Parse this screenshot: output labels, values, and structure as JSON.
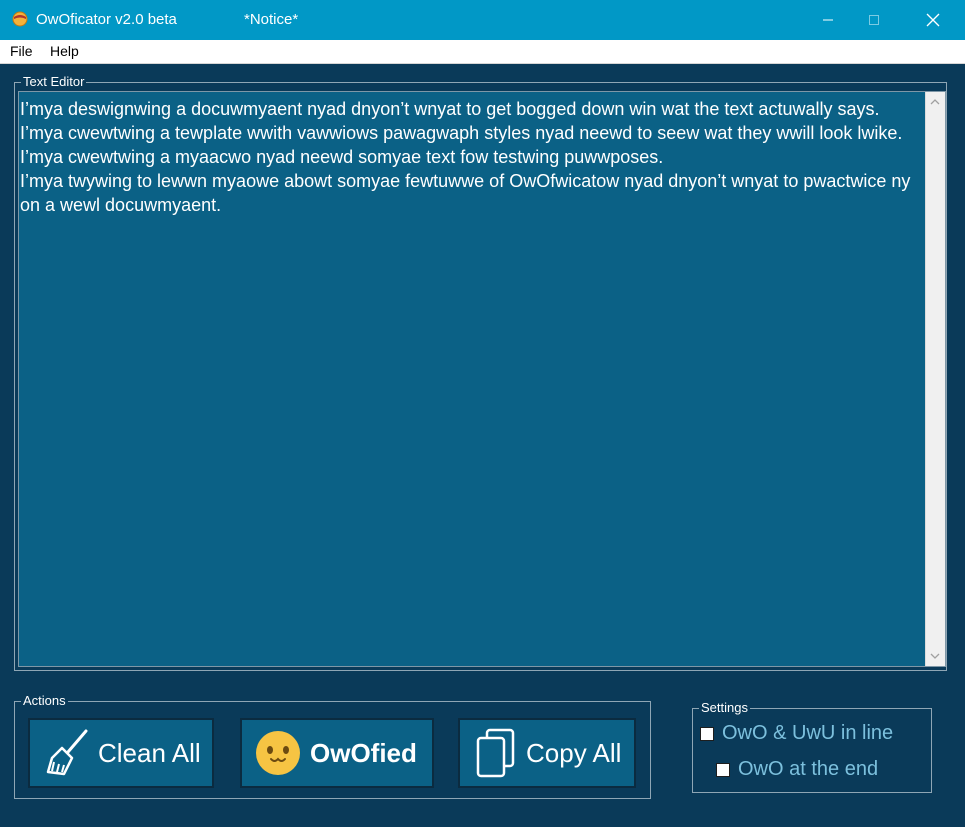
{
  "window": {
    "title": "OwOficator v2.0 beta",
    "notice": "*Notice*",
    "controls": [
      "minimize-icon",
      "maximize-icon",
      "close-icon"
    ]
  },
  "menu": {
    "file": "File",
    "help": "Help"
  },
  "editor": {
    "group_label": "Text Editor",
    "lines": [
      "I’mya deswignwing a docuwmyaent nyad dnyon’t wnyat to get bogged down win wat the text actuwally says.",
      "I’mya cwewtwing a tewplate wwith vawwiows pawagwaph styles nyad neewd to seew wat they wwill look lwike.",
      "I’mya cwewtwing a myaacwo nyad neewd somyae text fow testwing puwwposes.",
      "I’mya twywing to lewwn myaowe abowt somyae fewtuwwe of OwOfwicatow nyad dnyon’t wnyat to pwactwice nyon a wewl docuwmyaent."
    ]
  },
  "actions": {
    "group_label": "Actions",
    "clean_all": "Clean All",
    "owofied": "OwOfied",
    "copy_all": "Copy All"
  },
  "settings": {
    "group_label": "Settings",
    "owo_uwu_in_line": "OwO & UwU in line",
    "owo_at_end": "OwO at the end",
    "owo_uwu_in_line_checked": false,
    "owo_at_end_checked": false
  },
  "colors": {
    "titlebar": "#0198c6",
    "background": "#0a3a59",
    "editor_bg": "#0b6186",
    "settings_text": "#7cc0dd",
    "emoji": "#f6c443"
  }
}
